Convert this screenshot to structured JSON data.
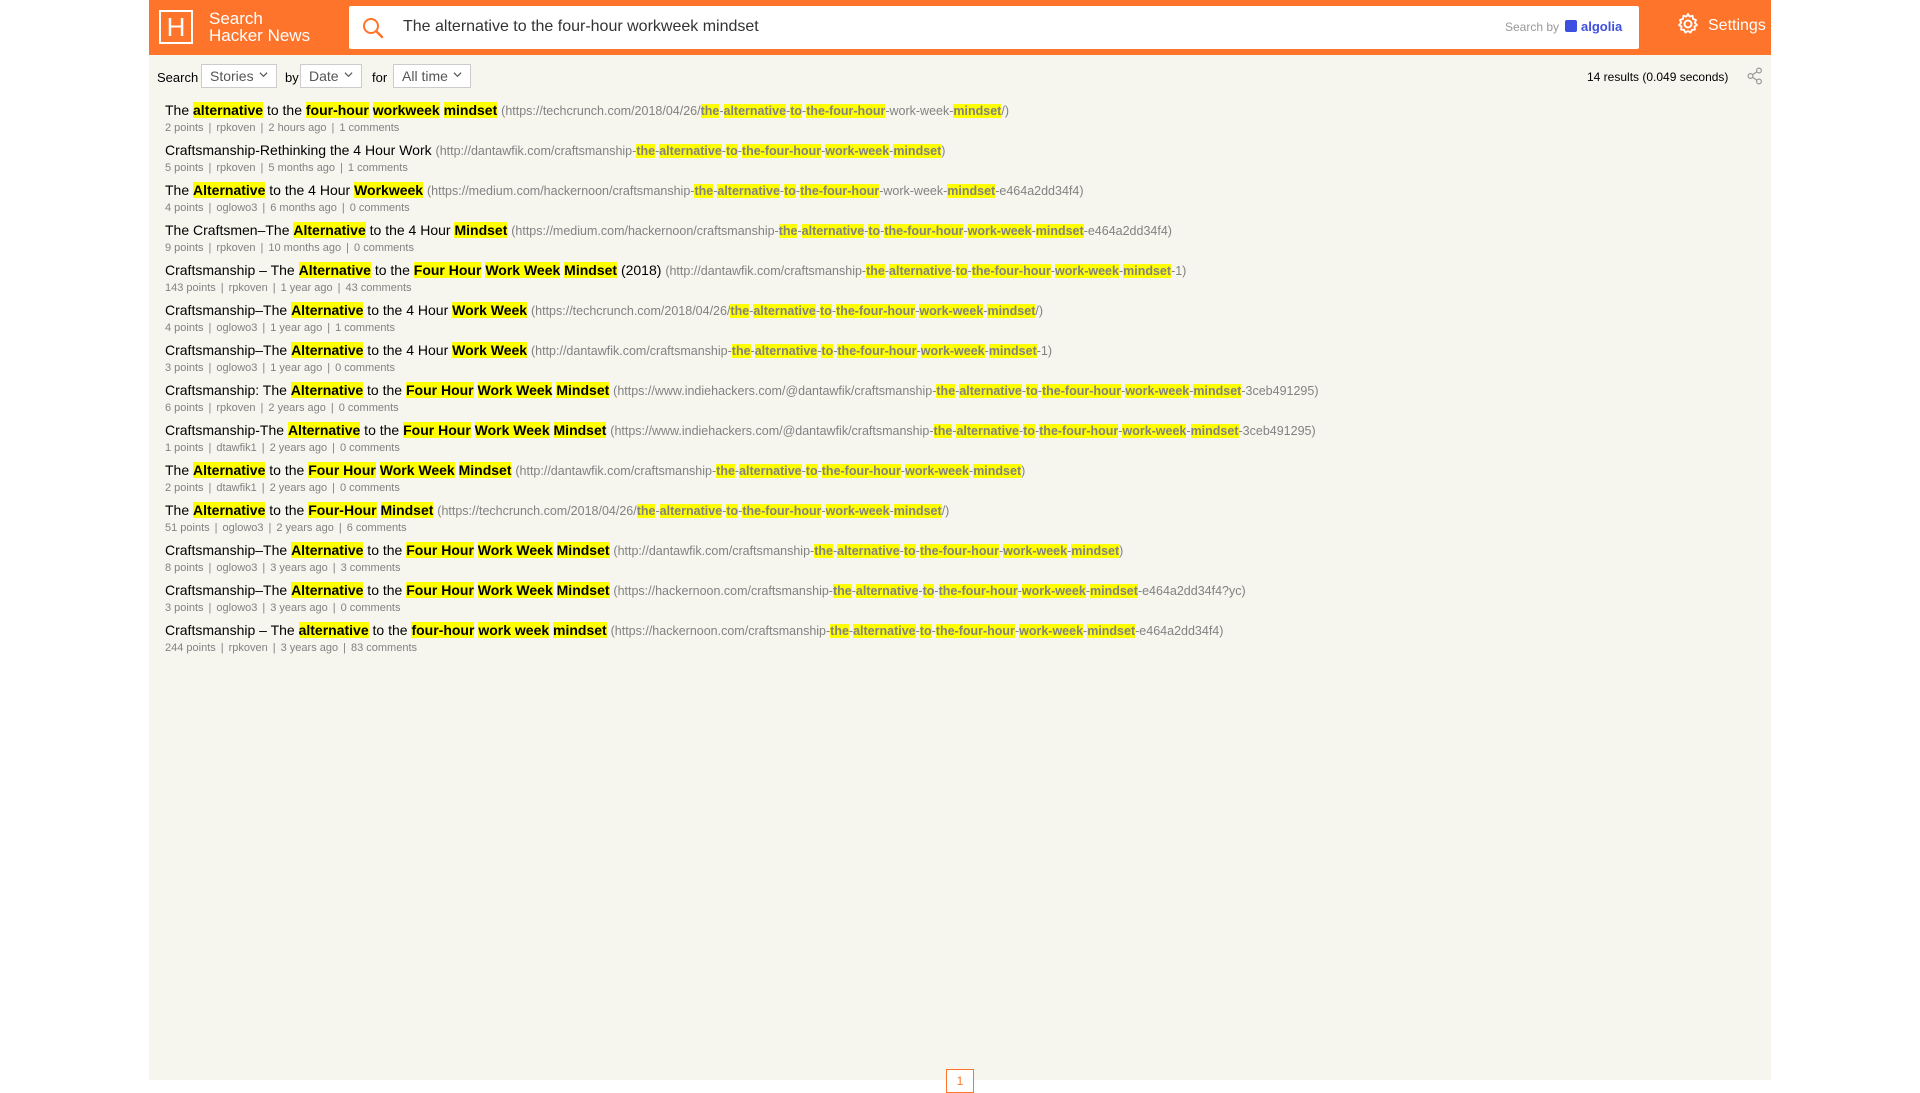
{
  "header": {
    "logo_letter": "H",
    "title_line1": "Search",
    "title_line2": "Hacker News",
    "query": "The alternative to the four-hour workweek mindset",
    "search_by": "Search by",
    "algolia": "algolia",
    "settings": "Settings"
  },
  "filters": {
    "search_label": "Search",
    "type_value": "Stories",
    "by_label": "by",
    "sort_value": "Date",
    "for_label": "for",
    "range_value": "All time",
    "results_text": "14 results (0.049 seconds)"
  },
  "results": [
    {
      "title": "The <em>alternative</em> to the <em>four-hour</em> <em>workweek</em> <em>mindset</em>",
      "url": "(https://techcrunch.com/2018/04/26/<em>the</em>-<em>alternative</em>-<em>to</em>-<em>the-four-hour</em>-work-week-<em>mindset</em>/)",
      "points": "2 points",
      "author": "rpkoven",
      "time": "2 hours ago",
      "comments": "1 comments"
    },
    {
      "title": "Craftsmanship-Rethinking the 4 Hour Work",
      "url": "(http://dantawfik.com/craftsmanship-<em>the</em>-<em>alternative</em>-<em>to</em>-<em>the-four-hour</em>-<em>work-week</em>-<em>mindset</em>)",
      "points": "5 points",
      "author": "rpkoven",
      "time": "5 months ago",
      "comments": "1 comments"
    },
    {
      "title": "The <em>Alternative</em> to the 4 Hour <em>Workweek</em>",
      "url": "(https://medium.com/hackernoon/craftsmanship-<em>the</em>-<em>alternative</em>-<em>to</em>-<em>the-four-hour</em>-work-week-<em>mindset</em>-e464a2dd34f4)",
      "points": "4 points",
      "author": "oglowo3",
      "time": "6 months ago",
      "comments": "0 comments"
    },
    {
      "title": "The Craftsmen–The <em>Alternative</em> to the 4 Hour <em>Mindset</em>",
      "url": "(https://medium.com/hackernoon/craftsmanship-<em>the</em>-<em>alternative</em>-<em>to</em>-<em>the-four-hour</em>-<em>work-week</em>-<em>mindset</em>-e464a2dd34f4)",
      "points": "9 points",
      "author": "rpkoven",
      "time": "10 months ago",
      "comments": "0 comments"
    },
    {
      "title": "Craftsmanship – The <em>Alternative</em> to the <em>Four Hour</em> <em>Work Week</em> <em>Mindset</em> (2018)",
      "url": "(http://dantawfik.com/craftsmanship-<em>the</em>-<em>alternative</em>-<em>to</em>-<em>the-four-hour</em>-<em>work-week</em>-<em>mindset</em>-1)",
      "points": "143 points",
      "author": "rpkoven",
      "time": "1 year ago",
      "comments": "43 comments"
    },
    {
      "title": "Craftsmanship–The <em>Alternative</em> to the 4 Hour <em>Work Week</em>",
      "url": "(https://techcrunch.com/2018/04/26/<em>the</em>-<em>alternative</em>-<em>to</em>-<em>the-four-hour</em>-<em>work-week</em>-<em>mindset</em>/)",
      "points": "4 points",
      "author": "oglowo3",
      "time": "1 year ago",
      "comments": "1 comments"
    },
    {
      "title": "Craftsmanship–The <em>Alternative</em> to the 4 Hour <em>Work Week</em>",
      "url": "(http://dantawfik.com/craftsmanship-<em>the</em>-<em>alternative</em>-<em>to</em>-<em>the-four-hour</em>-<em>work-week</em>-<em>mindset</em>-1)",
      "points": "3 points",
      "author": "oglowo3",
      "time": "1 year ago",
      "comments": "0 comments"
    },
    {
      "title": "Craftsmanship: The <em>Alternative</em> to the <em>Four Hour</em> <em>Work Week</em> <em>Mindset</em>",
      "url": "(https://www.indiehackers.com/@dantawfik/craftsmanship-<em>the</em>-<em>alternative</em>-<em>to</em>-<em>the-four-hour</em>-<em>work-week</em>-<em>mindset</em>-3ceb491295)",
      "points": "6 points",
      "author": "rpkoven",
      "time": "2 years ago",
      "comments": "0 comments"
    },
    {
      "title": "Craftsmanship-The <em>Alternative</em> to the <em>Four Hour</em> <em>Work Week</em> <em>Mindset</em>",
      "url": "(https://www.indiehackers.com/@dantawfik/craftsmanship-<em>the</em>-<em>alternative</em>-<em>to</em>-<em>the-four-hour</em>-<em>work-week</em>-<em>mindset</em>-3ceb491295)",
      "points": "1 points",
      "author": "dtawfik1",
      "time": "2 years ago",
      "comments": "0 comments"
    },
    {
      "title": "The <em>Alternative</em> to the <em>Four Hour</em> <em>Work Week</em> <em>Mindset</em>",
      "url": "(http://dantawfik.com/craftsmanship-<em>the</em>-<em>alternative</em>-<em>to</em>-<em>the-four-hour</em>-<em>work-week</em>-<em>mindset</em>)",
      "points": "2 points",
      "author": "dtawfik1",
      "time": "2 years ago",
      "comments": "0 comments"
    },
    {
      "title": "The <em>Alternative</em> to the <em>Four-Hour</em> <em>Mindset</em>",
      "url": "(https://techcrunch.com/2018/04/26/<em>the</em>-<em>alternative</em>-<em>to</em>-<em>the-four-hour</em>-<em>work-week</em>-<em>mindset</em>/)",
      "points": "51 points",
      "author": "oglowo3",
      "time": "2 years ago",
      "comments": "6 comments"
    },
    {
      "title": "Craftsmanship–The <em>Alternative</em> to the <em>Four Hour</em> <em>Work Week</em> <em>Mindset</em>",
      "url": "(http://dantawfik.com/craftsmanship-<em>the</em>-<em>alternative</em>-<em>to</em>-<em>the-four-hour</em>-<em>work-week</em>-<em>mindset</em>)",
      "points": "8 points",
      "author": "oglowo3",
      "time": "3 years ago",
      "comments": "3 comments"
    },
    {
      "title": "Craftsmanship–The <em>Alternative</em> to the <em>Four Hour</em> <em>Work Week</em> <em>Mindset</em>",
      "url": "(https://hackernoon.com/craftsmanship-<em>the</em>-<em>alternative</em>-<em>to</em>-<em>the-four-hour</em>-<em>work-week</em>-<em>mindset</em>-e464a2dd34f4?yc)",
      "points": "3 points",
      "author": "oglowo3",
      "time": "3 years ago",
      "comments": "0 comments"
    },
    {
      "title": "Craftsmanship – The <em>alternative</em> to the <em>four-hour</em> <em>work week</em> <em>mindset</em>",
      "url": "(https://hackernoon.com/craftsmanship-<em>the</em>-<em>alternative</em>-<em>to</em>-<em>the-four-hour</em>-<em>work-week</em>-<em>mindset</em>-e464a2dd34f4)",
      "points": "244 points",
      "author": "rpkoven",
      "time": "3 years ago",
      "comments": "83 comments"
    }
  ],
  "pagination": {
    "current": "1"
  },
  "colors": {
    "accent": "#ff742b",
    "highlight": "#ffff00",
    "muted": "#828282",
    "background": "#f6f6ef"
  }
}
